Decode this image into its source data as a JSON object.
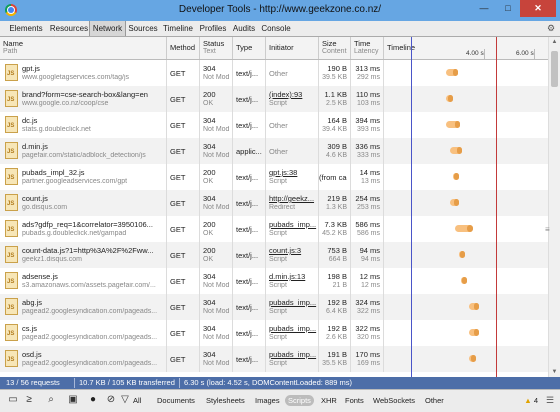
{
  "window": {
    "title": "Developer Tools - http://www.geekzone.co.nz/",
    "min": "—",
    "max": "□",
    "close": "✕"
  },
  "tabs": [
    "Elements",
    "Resources",
    "Network",
    "Sources",
    "Timeline",
    "Profiles",
    "Audits",
    "Console"
  ],
  "header": {
    "name": "Name",
    "path": "Path",
    "method": "Method",
    "status": "Status",
    "text": "Text",
    "type": "Type",
    "initiator": "Initiator",
    "size": "Size",
    "content": "Content",
    "time": "Time",
    "latency": "Latency",
    "timeline": "Timeline",
    "tick1": "4.00 s",
    "tick2": "6.00 s"
  },
  "rows": [
    {
      "name": "gpt.js",
      "path": "www.googletagservices.com/tag/js",
      "method": "GET",
      "status": "304",
      "text": "Not Mod",
      "type": "text/j...",
      "initiator": "Other",
      "initiator2": "",
      "ul": false,
      "size": "190 B",
      "content": "39.5 KB",
      "time": "313 ms",
      "latency": "292 ms",
      "bar_start_s": 4.0,
      "bar_wait_s": 0.15,
      "bar_recv_s": 0.13
    },
    {
      "name": "brand?form=cse-search-box&lang=en",
      "path": "www.google.co.nz/coop/cse",
      "method": "GET",
      "status": "200",
      "text": "OK",
      "type": "text/j...",
      "initiator": "(index):93",
      "initiator2": "Script",
      "ul": true,
      "size": "1.1 KB",
      "content": "2.5 KB",
      "time": "110 ms",
      "latency": "103 ms",
      "bar_start_s": 4.0,
      "bar_wait_s": 0.1,
      "bar_recv_s": 0.06
    },
    {
      "name": "dc.js",
      "path": "stats.g.doubleclick.net",
      "method": "GET",
      "status": "304",
      "text": "Not Mod",
      "type": "text/j...",
      "initiator": "Other",
      "initiator2": "",
      "ul": false,
      "size": "164 B",
      "content": "39.4 KB",
      "time": "394 ms",
      "latency": "393 ms",
      "bar_start_s": 4.0,
      "bar_wait_s": 0.2,
      "bar_recv_s": 0.12
    },
    {
      "name": "d.min.js",
      "path": "pagefair.com/static/adblock_detection/js",
      "method": "GET",
      "status": "304",
      "text": "Not Mod",
      "type": "applic...",
      "initiator": "Other",
      "initiator2": "",
      "ul": false,
      "size": "309 B",
      "content": "4.6 KB",
      "time": "336 ms",
      "latency": "333 ms",
      "bar_start_s": 4.1,
      "bar_wait_s": 0.18,
      "bar_recv_s": 0.1
    },
    {
      "name": "pubads_impl_32.js",
      "path": "partner.googleadservices.com/gpt",
      "method": "GET",
      "status": "200",
      "text": "OK",
      "type": "text/j...",
      "initiator": "gpt.js:38",
      "initiator2": "Script",
      "ul": true,
      "size": "(from cache)",
      "content": "",
      "time": "14 ms",
      "latency": "13 ms",
      "bar_start_s": 4.15,
      "bar_wait_s": 0.02,
      "bar_recv_s": 0.08
    },
    {
      "name": "count.js",
      "path": "go.disqus.com",
      "method": "GET",
      "status": "304",
      "text": "Not Mod",
      "type": "text/j...",
      "initiator": "http://geekz...",
      "initiator2": "Redirect",
      "ul": true,
      "size": "219 B",
      "content": "1.3 KB",
      "time": "254 ms",
      "latency": "253 ms",
      "bar_start_s": 4.1,
      "bar_wait_s": 0.12,
      "bar_recv_s": 0.08
    },
    {
      "name": "ads?gdfp_req=1&correlator=3950106...",
      "path": "pubads.g.doubleclick.net/gampad",
      "method": "GET",
      "status": "200",
      "text": "OK",
      "type": "text/j...",
      "initiator": "pubads_imp...",
      "initiator2": "Script",
      "ul": true,
      "size": "7.3 KB",
      "content": "45.2 KB",
      "time": "586 ms",
      "latency": "586 ms",
      "bar_start_s": 4.2,
      "bar_wait_s": 0.3,
      "bar_recv_s": 0.15
    },
    {
      "name": "count-data.js?1=http%3A%2F%2Fww...",
      "path": "geekz1.disqus.com",
      "method": "GET",
      "status": "200",
      "text": "OK",
      "type": "text/j...",
      "initiator": "count.js:3",
      "initiator2": "Script",
      "ul": true,
      "size": "753 B",
      "content": "664 B",
      "time": "94 ms",
      "latency": "94 ms",
      "bar_start_s": 4.3,
      "bar_wait_s": 0.08,
      "bar_recv_s": 0.05
    },
    {
      "name": "adsense.js",
      "path": "s3.amazonaws.com/assets.pagefair.com/...",
      "method": "GET",
      "status": "304",
      "text": "Not Mod",
      "type": "text/j...",
      "initiator": "d.min.js:13",
      "initiator2": "Script",
      "ul": true,
      "size": "198 B",
      "content": "21 B",
      "time": "12 ms",
      "latency": "12 ms",
      "bar_start_s": 4.35,
      "bar_wait_s": 0.02,
      "bar_recv_s": 0.06
    },
    {
      "name": "abg.js",
      "path": "pagead2.googlesyndication.com/pageads...",
      "method": "GET",
      "status": "304",
      "text": "Not Mod",
      "type": "text/j...",
      "initiator": "pubads_imp...",
      "initiator2": "Script",
      "ul": true,
      "size": "192 B",
      "content": "6.4 KB",
      "time": "324 ms",
      "latency": "322 ms",
      "bar_start_s": 4.55,
      "bar_wait_s": 0.15,
      "bar_recv_s": 0.1
    },
    {
      "name": "cs.js",
      "path": "pagead2.googlesyndication.com/pageads...",
      "method": "GET",
      "status": "304",
      "text": "Not Mod",
      "type": "text/j...",
      "initiator": "pubads_imp...",
      "initiator2": "Script",
      "ul": true,
      "size": "192 B",
      "content": "2.6 KB",
      "time": "322 ms",
      "latency": "320 ms",
      "bar_start_s": 4.55,
      "bar_wait_s": 0.15,
      "bar_recv_s": 0.1
    },
    {
      "name": "osd.js",
      "path": "pagead2.googlesyndication.com/pageads...",
      "method": "GET",
      "status": "304",
      "text": "Not Mod",
      "type": "text/j...",
      "initiator": "pubads_imp...",
      "initiator2": "Script",
      "ul": true,
      "size": "191 B",
      "content": "35.5 KB",
      "time": "170 ms",
      "latency": "169 ms",
      "bar_start_s": 4.55,
      "bar_wait_s": 0.08,
      "bar_recv_s": 0.08
    }
  ],
  "timeline_scale": {
    "min_s": 2.5,
    "max_s": 6.45
  },
  "status": {
    "requests": "13 / 56 requests",
    "transferred": "10.7 KB / 105 KB transferred",
    "timing": "6.30 s (load: 4.52 s, DOMContentLoaded: 889 ms)"
  },
  "filters": [
    "All",
    "Documents",
    "Stylesheets",
    "Images",
    "Scripts",
    "XHR",
    "Fonts",
    "WebSockets",
    "Other"
  ],
  "active_filter": "Scripts",
  "warnings": "4",
  "colors": {
    "titlebar": "#66a6e3",
    "status": "#4d6ea8",
    "bar": "#f8c07f",
    "bar_recv": "#e69d48",
    "dom_line": "#4a55c8",
    "load_line": "#c33a3a"
  }
}
